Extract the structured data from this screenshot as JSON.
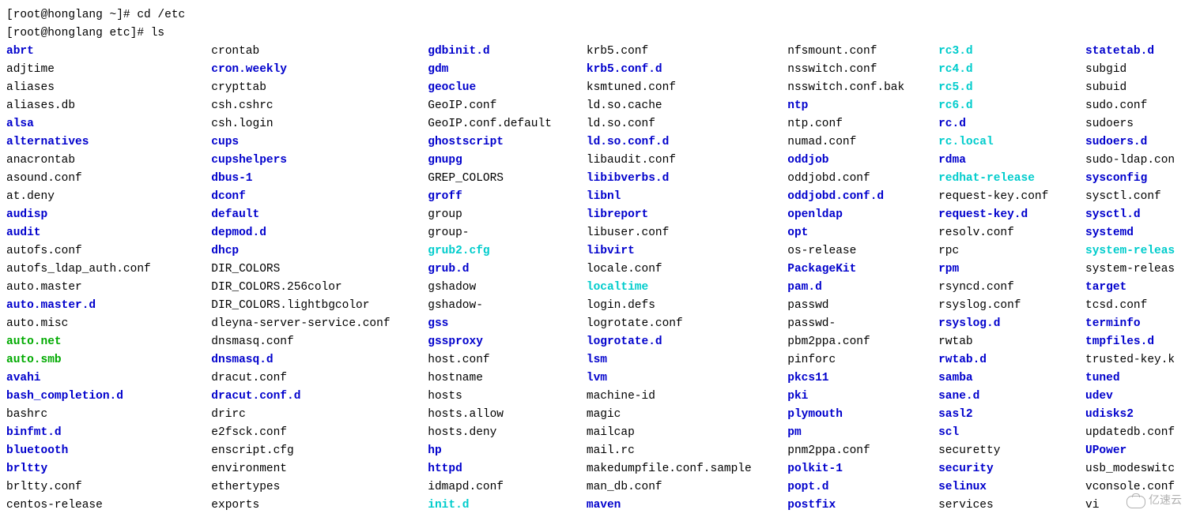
{
  "prompts": [
    "[root@honglang ~]# cd /etc",
    "[root@honglang etc]# ls"
  ],
  "watermark": "亿速云",
  "columns": [
    [
      {
        "name": "abrt",
        "type": "dir"
      },
      {
        "name": "adjtime",
        "type": "file"
      },
      {
        "name": "aliases",
        "type": "file"
      },
      {
        "name": "aliases.db",
        "type": "file"
      },
      {
        "name": "alsa",
        "type": "dir"
      },
      {
        "name": "alternatives",
        "type": "dir"
      },
      {
        "name": "anacrontab",
        "type": "file"
      },
      {
        "name": "asound.conf",
        "type": "file"
      },
      {
        "name": "at.deny",
        "type": "file"
      },
      {
        "name": "audisp",
        "type": "dir"
      },
      {
        "name": "audit",
        "type": "dir"
      },
      {
        "name": "autofs.conf",
        "type": "file"
      },
      {
        "name": "autofs_ldap_auth.conf",
        "type": "file"
      },
      {
        "name": "auto.master",
        "type": "file"
      },
      {
        "name": "auto.master.d",
        "type": "dir"
      },
      {
        "name": "auto.misc",
        "type": "file"
      },
      {
        "name": "auto.net",
        "type": "exec"
      },
      {
        "name": "auto.smb",
        "type": "exec"
      },
      {
        "name": "avahi",
        "type": "dir"
      },
      {
        "name": "bash_completion.d",
        "type": "dir"
      },
      {
        "name": "bashrc",
        "type": "file"
      },
      {
        "name": "binfmt.d",
        "type": "dir"
      },
      {
        "name": "bluetooth",
        "type": "dir"
      },
      {
        "name": "brltty",
        "type": "dir"
      },
      {
        "name": "brltty.conf",
        "type": "file"
      },
      {
        "name": "centos-release",
        "type": "file"
      }
    ],
    [
      {
        "name": "crontab",
        "type": "file"
      },
      {
        "name": "cron.weekly",
        "type": "dir"
      },
      {
        "name": "crypttab",
        "type": "file"
      },
      {
        "name": "csh.cshrc",
        "type": "file"
      },
      {
        "name": "csh.login",
        "type": "file"
      },
      {
        "name": "cups",
        "type": "dir"
      },
      {
        "name": "cupshelpers",
        "type": "dir"
      },
      {
        "name": "dbus-1",
        "type": "dir"
      },
      {
        "name": "dconf",
        "type": "dir"
      },
      {
        "name": "default",
        "type": "dir"
      },
      {
        "name": "depmod.d",
        "type": "dir"
      },
      {
        "name": "dhcp",
        "type": "dir"
      },
      {
        "name": "DIR_COLORS",
        "type": "file"
      },
      {
        "name": "DIR_COLORS.256color",
        "type": "file"
      },
      {
        "name": "DIR_COLORS.lightbgcolor",
        "type": "file"
      },
      {
        "name": "dleyna-server-service.conf",
        "type": "file"
      },
      {
        "name": "dnsmasq.conf",
        "type": "file"
      },
      {
        "name": "dnsmasq.d",
        "type": "dir"
      },
      {
        "name": "dracut.conf",
        "type": "file"
      },
      {
        "name": "dracut.conf.d",
        "type": "dir"
      },
      {
        "name": "drirc",
        "type": "file"
      },
      {
        "name": "e2fsck.conf",
        "type": "file"
      },
      {
        "name": "enscript.cfg",
        "type": "file"
      },
      {
        "name": "environment",
        "type": "file"
      },
      {
        "name": "ethertypes",
        "type": "file"
      },
      {
        "name": "exports",
        "type": "file"
      }
    ],
    [
      {
        "name": "gdbinit.d",
        "type": "dir"
      },
      {
        "name": "gdm",
        "type": "dir"
      },
      {
        "name": "geoclue",
        "type": "dir"
      },
      {
        "name": "GeoIP.conf",
        "type": "file"
      },
      {
        "name": "GeoIP.conf.default",
        "type": "file"
      },
      {
        "name": "ghostscript",
        "type": "dir"
      },
      {
        "name": "gnupg",
        "type": "dir"
      },
      {
        "name": "GREP_COLORS",
        "type": "file"
      },
      {
        "name": "groff",
        "type": "dir"
      },
      {
        "name": "group",
        "type": "file"
      },
      {
        "name": "group-",
        "type": "file"
      },
      {
        "name": "grub2.cfg",
        "type": "link"
      },
      {
        "name": "grub.d",
        "type": "dir"
      },
      {
        "name": "gshadow",
        "type": "file"
      },
      {
        "name": "gshadow-",
        "type": "file"
      },
      {
        "name": "gss",
        "type": "dir"
      },
      {
        "name": "gssproxy",
        "type": "dir"
      },
      {
        "name": "host.conf",
        "type": "file"
      },
      {
        "name": "hostname",
        "type": "file"
      },
      {
        "name": "hosts",
        "type": "file"
      },
      {
        "name": "hosts.allow",
        "type": "file"
      },
      {
        "name": "hosts.deny",
        "type": "file"
      },
      {
        "name": "hp",
        "type": "dir"
      },
      {
        "name": "httpd",
        "type": "dir"
      },
      {
        "name": "idmapd.conf",
        "type": "file"
      },
      {
        "name": "init.d",
        "type": "link"
      }
    ],
    [
      {
        "name": "krb5.conf",
        "type": "file"
      },
      {
        "name": "krb5.conf.d",
        "type": "dir"
      },
      {
        "name": "ksmtuned.conf",
        "type": "file"
      },
      {
        "name": "ld.so.cache",
        "type": "file"
      },
      {
        "name": "ld.so.conf",
        "type": "file"
      },
      {
        "name": "ld.so.conf.d",
        "type": "dir"
      },
      {
        "name": "libaudit.conf",
        "type": "file"
      },
      {
        "name": "libibverbs.d",
        "type": "dir"
      },
      {
        "name": "libnl",
        "type": "dir"
      },
      {
        "name": "libreport",
        "type": "dir"
      },
      {
        "name": "libuser.conf",
        "type": "file"
      },
      {
        "name": "libvirt",
        "type": "dir"
      },
      {
        "name": "locale.conf",
        "type": "file"
      },
      {
        "name": "localtime",
        "type": "link"
      },
      {
        "name": "login.defs",
        "type": "file"
      },
      {
        "name": "logrotate.conf",
        "type": "file"
      },
      {
        "name": "logrotate.d",
        "type": "dir"
      },
      {
        "name": "lsm",
        "type": "dir"
      },
      {
        "name": "lvm",
        "type": "dir"
      },
      {
        "name": "machine-id",
        "type": "file"
      },
      {
        "name": "magic",
        "type": "file"
      },
      {
        "name": "mailcap",
        "type": "file"
      },
      {
        "name": "mail.rc",
        "type": "file"
      },
      {
        "name": "makedumpfile.conf.sample",
        "type": "file"
      },
      {
        "name": "man_db.conf",
        "type": "file"
      },
      {
        "name": "maven",
        "type": "dir"
      }
    ],
    [
      {
        "name": "nfsmount.conf",
        "type": "file"
      },
      {
        "name": "nsswitch.conf",
        "type": "file"
      },
      {
        "name": "nsswitch.conf.bak",
        "type": "file"
      },
      {
        "name": "ntp",
        "type": "dir"
      },
      {
        "name": "ntp.conf",
        "type": "file"
      },
      {
        "name": "numad.conf",
        "type": "file"
      },
      {
        "name": "oddjob",
        "type": "dir"
      },
      {
        "name": "oddjobd.conf",
        "type": "file"
      },
      {
        "name": "oddjobd.conf.d",
        "type": "dir"
      },
      {
        "name": "openldap",
        "type": "dir"
      },
      {
        "name": "opt",
        "type": "dir"
      },
      {
        "name": "os-release",
        "type": "file"
      },
      {
        "name": "PackageKit",
        "type": "dir"
      },
      {
        "name": "pam.d",
        "type": "dir"
      },
      {
        "name": "passwd",
        "type": "file"
      },
      {
        "name": "passwd-",
        "type": "file"
      },
      {
        "name": "pbm2ppa.conf",
        "type": "file"
      },
      {
        "name": "pinforc",
        "type": "file"
      },
      {
        "name": "pkcs11",
        "type": "dir"
      },
      {
        "name": "pki",
        "type": "dir"
      },
      {
        "name": "plymouth",
        "type": "dir"
      },
      {
        "name": "pm",
        "type": "dir"
      },
      {
        "name": "pnm2ppa.conf",
        "type": "file"
      },
      {
        "name": "polkit-1",
        "type": "dir"
      },
      {
        "name": "popt.d",
        "type": "dir"
      },
      {
        "name": "postfix",
        "type": "dir"
      }
    ],
    [
      {
        "name": "rc3.d",
        "type": "link"
      },
      {
        "name": "rc4.d",
        "type": "link"
      },
      {
        "name": "rc5.d",
        "type": "link"
      },
      {
        "name": "rc6.d",
        "type": "link"
      },
      {
        "name": "rc.d",
        "type": "dir"
      },
      {
        "name": "rc.local",
        "type": "link"
      },
      {
        "name": "rdma",
        "type": "dir"
      },
      {
        "name": "redhat-release",
        "type": "link"
      },
      {
        "name": "request-key.conf",
        "type": "file"
      },
      {
        "name": "request-key.d",
        "type": "dir"
      },
      {
        "name": "resolv.conf",
        "type": "file"
      },
      {
        "name": "rpc",
        "type": "file"
      },
      {
        "name": "rpm",
        "type": "dir"
      },
      {
        "name": "rsyncd.conf",
        "type": "file"
      },
      {
        "name": "rsyslog.conf",
        "type": "file"
      },
      {
        "name": "rsyslog.d",
        "type": "dir"
      },
      {
        "name": "rwtab",
        "type": "file"
      },
      {
        "name": "rwtab.d",
        "type": "dir"
      },
      {
        "name": "samba",
        "type": "dir"
      },
      {
        "name": "sane.d",
        "type": "dir"
      },
      {
        "name": "sasl2",
        "type": "dir"
      },
      {
        "name": "scl",
        "type": "dir"
      },
      {
        "name": "securetty",
        "type": "file"
      },
      {
        "name": "security",
        "type": "dir"
      },
      {
        "name": "selinux",
        "type": "dir"
      },
      {
        "name": "services",
        "type": "file"
      }
    ],
    [
      {
        "name": "statetab.d",
        "type": "dir"
      },
      {
        "name": "subgid",
        "type": "file"
      },
      {
        "name": "subuid",
        "type": "file"
      },
      {
        "name": "sudo.conf",
        "type": "file"
      },
      {
        "name": "sudoers",
        "type": "file"
      },
      {
        "name": "sudoers.d",
        "type": "dir"
      },
      {
        "name": "sudo-ldap.con",
        "type": "file"
      },
      {
        "name": "sysconfig",
        "type": "dir"
      },
      {
        "name": "sysctl.conf",
        "type": "file"
      },
      {
        "name": "sysctl.d",
        "type": "dir"
      },
      {
        "name": "systemd",
        "type": "dir"
      },
      {
        "name": "system-releas",
        "type": "link"
      },
      {
        "name": "system-releas",
        "type": "file"
      },
      {
        "name": "target",
        "type": "dir"
      },
      {
        "name": "tcsd.conf",
        "type": "file"
      },
      {
        "name": "terminfo",
        "type": "dir"
      },
      {
        "name": "tmpfiles.d",
        "type": "dir"
      },
      {
        "name": "trusted-key.k",
        "type": "file"
      },
      {
        "name": "tuned",
        "type": "dir"
      },
      {
        "name": "udev",
        "type": "dir"
      },
      {
        "name": "udisks2",
        "type": "dir"
      },
      {
        "name": "updatedb.conf",
        "type": "file"
      },
      {
        "name": "UPower",
        "type": "dir"
      },
      {
        "name": "usb_modeswitc",
        "type": "file"
      },
      {
        "name": "vconsole.conf",
        "type": "file"
      },
      {
        "name": "vi",
        "type": "file"
      }
    ]
  ]
}
